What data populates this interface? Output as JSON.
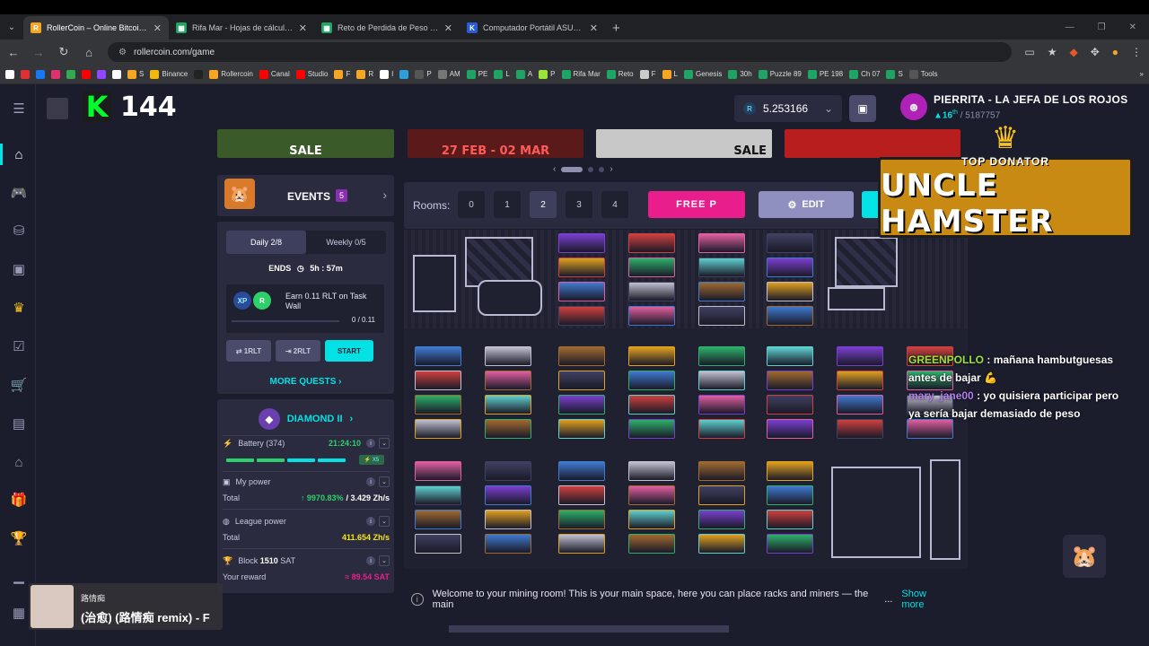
{
  "browser": {
    "tabs": [
      {
        "label": "RollerCoin – Online Bitcoin Mining",
        "active": true,
        "fav_color": "#f6a623",
        "fav": "R"
      },
      {
        "label": "Rifa Mar - Hojas de cálculo de Google",
        "active": false,
        "fav_color": "#1fa463",
        "fav": "▦"
      },
      {
        "label": "Reto de Perdida de Peso - El Mejor",
        "active": false,
        "fav_color": "#1fa463",
        "fav": "▦"
      },
      {
        "label": "Computador Portátil ASUS Vivobook",
        "active": false,
        "fav_color": "#2a5bd7",
        "fav": "K"
      }
    ],
    "url": "rollercoin.com/game",
    "bookmarks": [
      {
        "label": "",
        "c": "#fff"
      },
      {
        "label": "",
        "c": "#e03030"
      },
      {
        "label": "",
        "c": "#1877f2"
      },
      {
        "label": "",
        "c": "#e1306c"
      },
      {
        "label": "",
        "c": "#34a853"
      },
      {
        "label": "",
        "c": "#ff0000"
      },
      {
        "label": "",
        "c": "#9146ff"
      },
      {
        "label": "",
        "c": "#ffffff"
      },
      {
        "label": "S",
        "c": "#f6a623"
      },
      {
        "label": "Binance",
        "c": "#f0b90b"
      },
      {
        "label": "",
        "c": "#222"
      },
      {
        "label": "Rollercoin",
        "c": "#f6a623"
      },
      {
        "label": "Canal",
        "c": "#ff0000"
      },
      {
        "label": "Studio",
        "c": "#ff0000"
      },
      {
        "label": "F",
        "c": "#f6a623"
      },
      {
        "label": "R",
        "c": "#f6a623"
      },
      {
        "label": "I",
        "c": "#fff"
      },
      {
        "label": "",
        "c": "#2aa1da"
      },
      {
        "label": "P",
        "c": "#555"
      },
      {
        "label": "AM",
        "c": "#777"
      },
      {
        "label": "PE",
        "c": "#1fa463"
      },
      {
        "label": "L",
        "c": "#1fa463"
      },
      {
        "label": "A",
        "c": "#1fa463"
      },
      {
        "label": "P",
        "c": "#9be53b"
      },
      {
        "label": "Rifa Mar",
        "c": "#1fa463"
      },
      {
        "label": "Reto",
        "c": "#1fa463"
      },
      {
        "label": "F",
        "c": "#ccc"
      },
      {
        "label": "L",
        "c": "#f6a623"
      },
      {
        "label": "Genesis",
        "c": "#1fa463"
      },
      {
        "label": "30h",
        "c": "#1fa463"
      },
      {
        "label": "Puzzle 89",
        "c": "#1fa463"
      },
      {
        "label": "PE 198",
        "c": "#1fa463"
      },
      {
        "label": "Ch 07",
        "c": "#1fa463"
      },
      {
        "label": "S",
        "c": "#1fa463"
      },
      {
        "label": "Tools",
        "c": "#555"
      }
    ]
  },
  "header": {
    "k_letter": "K",
    "k_count": "144",
    "balance": "5.253166",
    "balance_currency_icon": "R",
    "user_name": "PIERRITA - LA JEFA DE LOS ROJOS",
    "user_rank_prefix": "▲16",
    "user_rank_suffix": "th",
    "user_rank_total": "/ 5187757"
  },
  "banners": [
    {
      "text": "SALE",
      "bg": "#3a5a2a",
      "color": "#fff"
    },
    {
      "text": "27 FEB - 02 MAR",
      "bg": "#5a1a1a",
      "color": "#ff5a5a"
    },
    {
      "text": "SALE",
      "bg": "#c8c8c8",
      "color": "#111"
    },
    {
      "text": "",
      "bg": "#b81e1e",
      "color": "#fff"
    }
  ],
  "events": {
    "label": "EVENTS",
    "count": "5"
  },
  "quests": {
    "tab_daily": "Daily 2/8",
    "tab_weekly": "Weekly 0/5",
    "ends_label": "ENDS",
    "ends_value": "5h : 57m",
    "task_text": "Earn 0.11 RLT on Task Wall",
    "task_progress": "0 / 0.11",
    "task_progress_fraction": 0.0,
    "btn_1": "⇄ 1RLT",
    "btn_2": "⇥ 2RLT",
    "btn_start": "START",
    "more": "MORE QUESTS ›"
  },
  "league": {
    "name": "DIAMOND II",
    "battery_label": "Battery (374)",
    "battery_time": "21:24:10",
    "battery_badge": "⚡ X5",
    "my_power_label": "My power",
    "total_label": "Total",
    "my_power_pct": "↑ 9970.83%",
    "my_power_value": "/ 3.429 Zh/s",
    "league_power_label": "League power",
    "league_total": "411.654 Zh/s",
    "block_label": "Block",
    "block_value": "1510",
    "block_unit": "SAT",
    "reward_label": "Your reward",
    "reward_value": "≈ 89.54 SAT"
  },
  "rooms": {
    "label": "Rooms:",
    "numbers": [
      "0",
      "1",
      "2",
      "3",
      "4"
    ],
    "active": "2",
    "free_label": "FREE P",
    "edit_label": "EDIT"
  },
  "donor": {
    "top": "TOP DONATOR",
    "name": "UNCLE HAMSTER"
  },
  "chat": [
    {
      "name": "GREENPOLLO",
      "text": ": mañana hambutguesas antes de bajar 💪"
    },
    {
      "name": "mary_jane00",
      "text": ": yo quisiera participar pero ya sería bajar demasiado de peso"
    }
  ],
  "welcome": {
    "text": "Welcome to your mining room! This is your main space, here you can place racks and miners — the main",
    "ellipsis": "...",
    "show_more": "Show more"
  },
  "music": {
    "artist": "路情痴",
    "song": "(治愈) (路情痴 remix) - F"
  }
}
